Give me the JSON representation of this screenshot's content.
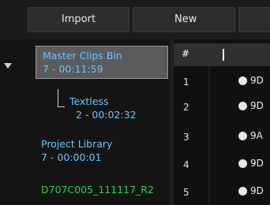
{
  "toolbar": {
    "import_label": "Import",
    "new_label": "New"
  },
  "bins": {
    "selected": {
      "name": "Master Clips Bin",
      "meta": "7 - 00:11:59"
    },
    "child": {
      "name": "Textless",
      "meta": "2 - 00:02:32"
    },
    "library": {
      "name": "Project Library",
      "meta": "7 - 00:00:01"
    },
    "clip": {
      "name": "D707C005_111117_R2"
    }
  },
  "table": {
    "header_num": "#",
    "rows": [
      {
        "num": "1",
        "name": "9D"
      },
      {
        "num": "2",
        "name": "9D"
      },
      {
        "num": "3",
        "name": "9A"
      },
      {
        "num": "4",
        "name": "9D"
      },
      {
        "num": "5",
        "name": "9D"
      }
    ]
  },
  "colors": {
    "bin_text": "#66c6ff",
    "clip_text": "#27d44a",
    "selected_bg": "#5b5b5b"
  }
}
